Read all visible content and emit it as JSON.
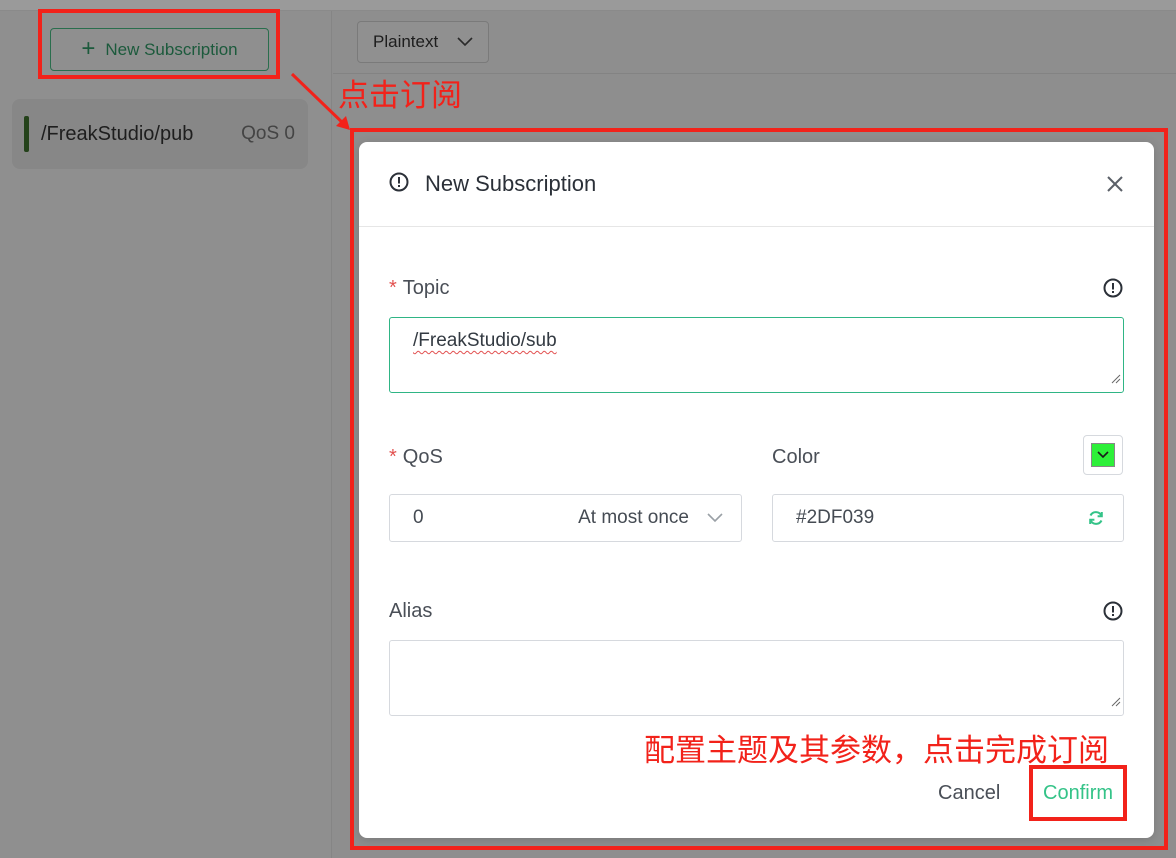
{
  "sidebar": {
    "new_subscription_label": "New Subscription",
    "subscriptions": [
      {
        "topic": "/FreakStudio/pub",
        "qos_label": "QoS 0",
        "color": "#24421a"
      }
    ]
  },
  "header": {
    "payload_format": "Plaintext"
  },
  "modal": {
    "title": "New Subscription",
    "topic": {
      "required_mark": "*",
      "label": "Topic",
      "value": "/FreakStudio/sub"
    },
    "qos": {
      "required_mark": "*",
      "label": "QoS",
      "value": "0",
      "description": "At most once"
    },
    "color": {
      "label": "Color",
      "value": "#2DF039"
    },
    "alias": {
      "label": "Alias",
      "value": ""
    },
    "cancel_label": "Cancel",
    "confirm_label": "Confirm"
  },
  "annotations": {
    "click_subscribe": "点击订阅",
    "configure_hint": "配置主题及其参数，点击完成订阅"
  },
  "colors": {
    "accent": "#34c388",
    "annotation_red": "#f2221a",
    "required_red": "#e2514f"
  }
}
